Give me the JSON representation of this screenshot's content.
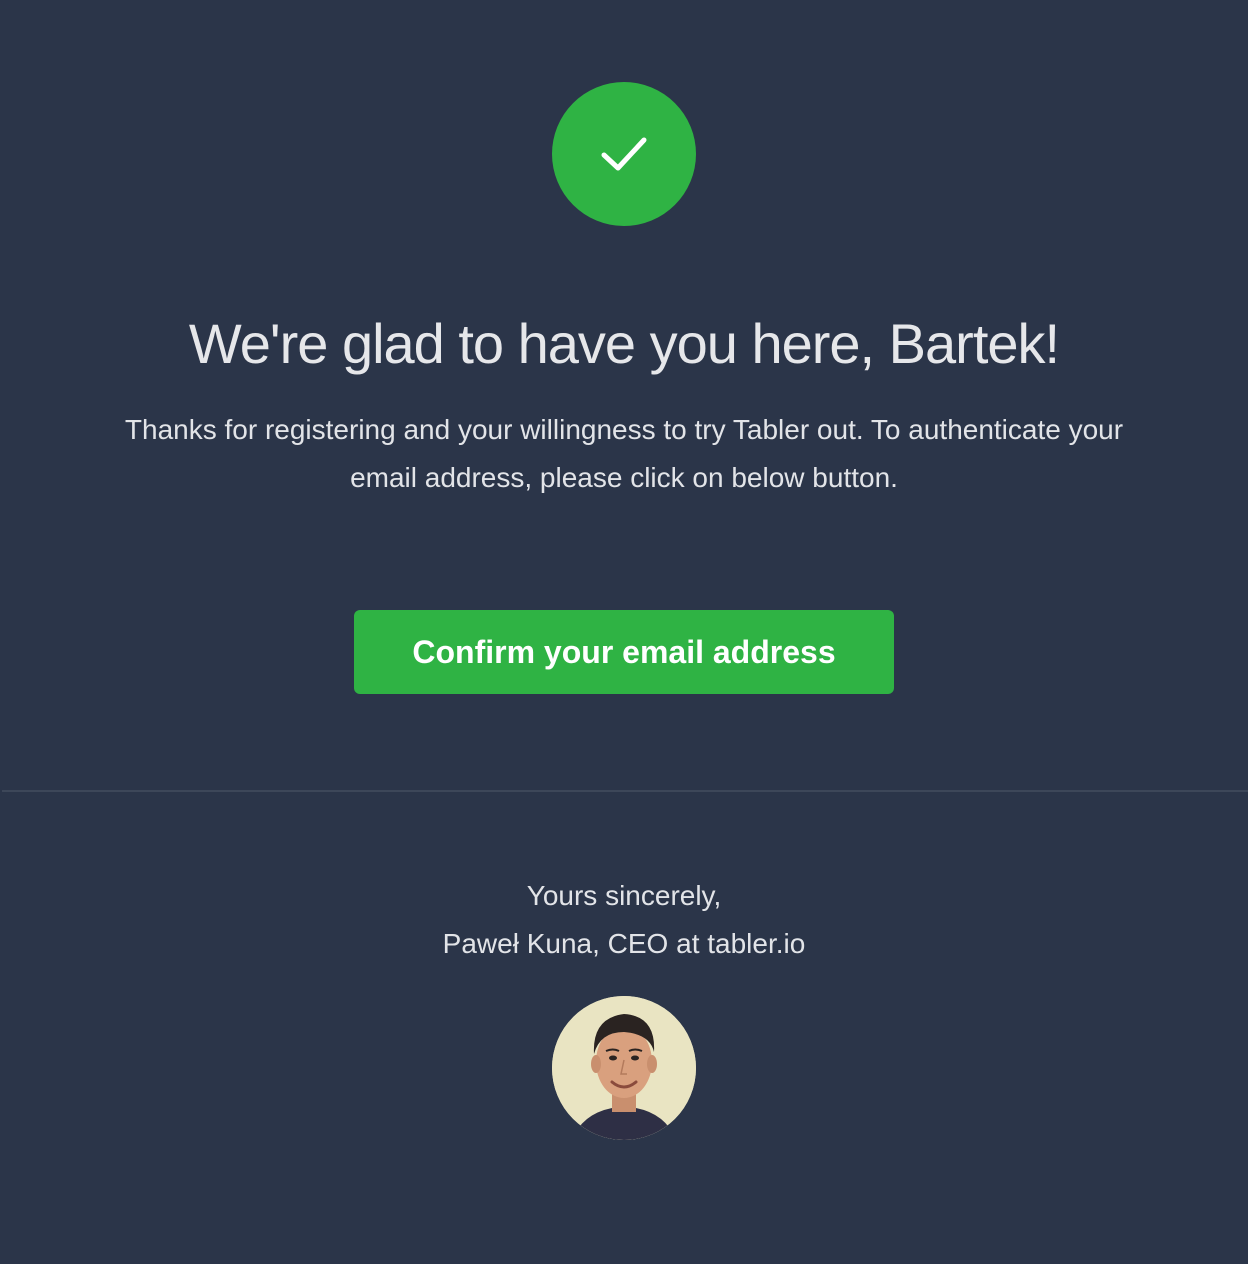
{
  "colors": {
    "background": "#2b3549",
    "accent": "#2fb344",
    "text": "#e4e6ea"
  },
  "hero": {
    "icon": "check-icon"
  },
  "heading": {
    "title": "We're glad to have you here, Bartek!"
  },
  "message": {
    "body": "Thanks for registering and your willingness to try Tabler out. To authenticate your email address, please click on below button."
  },
  "actions": {
    "confirm_label": "Confirm your email address"
  },
  "signature": {
    "closing": "Yours sincerely,",
    "author": "Paweł Kuna, CEO at tabler.io",
    "avatar_icon": "avatar-photo"
  }
}
